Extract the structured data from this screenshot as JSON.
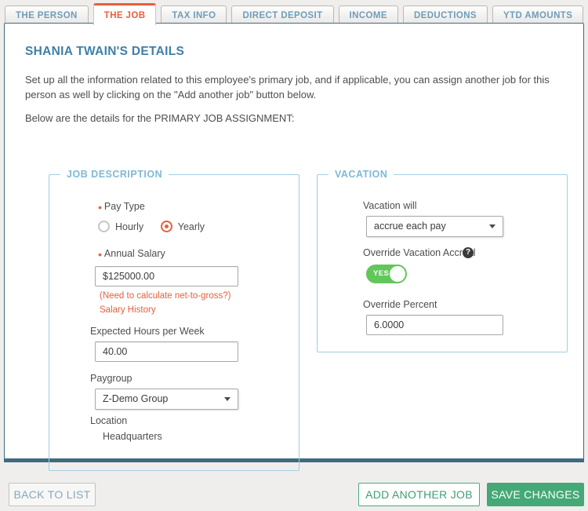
{
  "tabs": [
    {
      "label": "THE PERSON",
      "active": false
    },
    {
      "label": "THE JOB",
      "active": true
    },
    {
      "label": "TAX INFO",
      "active": false
    },
    {
      "label": "DIRECT DEPOSIT",
      "active": false
    },
    {
      "label": "INCOME",
      "active": false
    },
    {
      "label": "DEDUCTIONS",
      "active": false
    },
    {
      "label": "YTD AMOUNTS",
      "active": false
    }
  ],
  "page": {
    "title": "SHANIA TWAIN'S DETAILS",
    "intro": "Set up all the information related to this employee's primary job, and if applicable, you can assign another job for this person as well by clicking on the \"Add another job\" button below.",
    "subintro": "Below are the details for the PRIMARY JOB ASSIGNMENT:"
  },
  "job_description": {
    "legend": "JOB DESCRIPTION",
    "pay_type": {
      "label": "Pay Type",
      "options": [
        "Hourly",
        "Yearly"
      ],
      "selected": "Yearly"
    },
    "annual_salary": {
      "label": "Annual Salary",
      "value": "$125000.00",
      "net_to_gross_link": "(Need to calculate net-to-gross?)",
      "salary_history_link": "Salary History"
    },
    "expected_hours": {
      "label": "Expected Hours per Week",
      "value": "40.00"
    },
    "paygroup": {
      "label": "Paygroup",
      "value": "Z-Demo Group"
    },
    "location": {
      "label": "Location",
      "value": "Headquarters"
    }
  },
  "vacation": {
    "legend": "VACATION",
    "vacation_will": {
      "label": "Vacation will",
      "value": "accrue each pay"
    },
    "override_accrual": {
      "label": "Override Vacation Accrual",
      "help_icon": "?",
      "toggle_state": "YES"
    },
    "override_percent": {
      "label": "Override Percent",
      "value": "6.0000"
    }
  },
  "footer": {
    "back_to_list": "BACK TO LIST",
    "add_another_job": "ADD ANOTHER JOB",
    "save_changes": "SAVE CHANGES"
  },
  "colors": {
    "accent_orange": "#e8603c",
    "tab_blue": "#6e9cba",
    "title_blue": "#3f7fa8",
    "panel_border": "#3f6b80",
    "fieldset_blue": "#a4cee0",
    "toggle_green": "#61c75a",
    "save_green": "#45a877"
  }
}
